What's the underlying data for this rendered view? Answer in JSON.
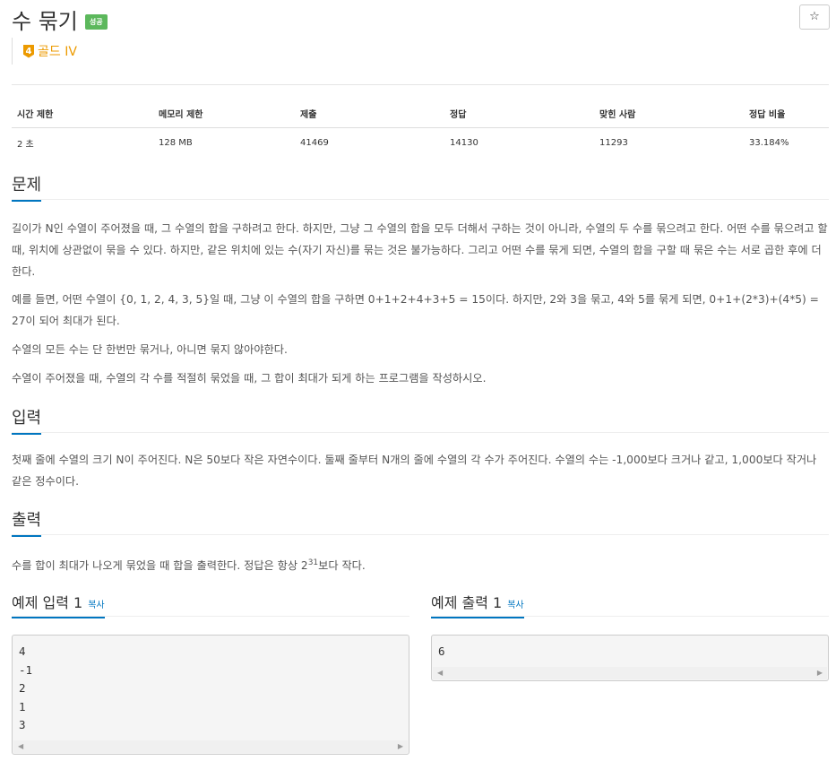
{
  "problem": {
    "title": "수 묶기",
    "status_badge": "성공",
    "star": "☆",
    "tier_number": "4",
    "tier_name": "골드 IV"
  },
  "stats": {
    "headers": [
      "시간 제한",
      "메모리 제한",
      "제출",
      "정답",
      "맞힌 사람",
      "정답 비율"
    ],
    "values": [
      "2 초",
      "128 MB",
      "41469",
      "14130",
      "11293",
      "33.184%"
    ]
  },
  "sections": {
    "problem_title": "문제",
    "problem_paragraphs": [
      "길이가 N인 수열이 주어졌을 때, 그 수열의 합을 구하려고 한다. 하지만, 그냥 그 수열의 합을 모두 더해서 구하는 것이 아니라, 수열의 두 수를 묶으려고 한다. 어떤 수를 묶으려고 할 때, 위치에 상관없이 묶을 수 있다. 하지만, 같은 위치에 있는 수(자기 자신)를 묶는 것은 불가능하다. 그리고 어떤 수를 묶게 되면, 수열의 합을 구할 때 묶은 수는 서로 곱한 후에 더한다.",
      "예를 들면, 어떤 수열이 {0, 1, 2, 4, 3, 5}일 때, 그냥 이 수열의 합을 구하면 0+1+2+4+3+5 = 15이다. 하지만, 2와 3을 묶고, 4와 5를 묶게 되면, 0+1+(2*3)+(4*5) = 27이 되어 최대가 된다.",
      "수열의 모든 수는 단 한번만 묶거나, 아니면 묶지 않아야한다.",
      "수열이 주어졌을 때, 수열의 각 수를 적절히 묶었을 때, 그 합이 최대가 되게 하는 프로그램을 작성하시오."
    ],
    "input_title": "입력",
    "input_text": "첫째 줄에 수열의 크기 N이 주어진다. N은 50보다 작은 자연수이다. 둘째 줄부터 N개의 줄에 수열의 각 수가 주어진다. 수열의 수는 -1,000보다 크거나 같고, 1,000보다 작거나 같은 정수이다.",
    "output_title": "출력",
    "output_text_before": "수를 합이 최대가 나오게 묶었을 때 합을 출력한다. 정답은 항상 2",
    "output_sup": "31",
    "output_text_after": "보다 작다."
  },
  "samples": {
    "input_title": "예제 입력 1",
    "output_title": "예제 출력 1",
    "copy_label": "복사",
    "input_text": "4\n-1\n2\n1\n3",
    "output_text": "6"
  }
}
